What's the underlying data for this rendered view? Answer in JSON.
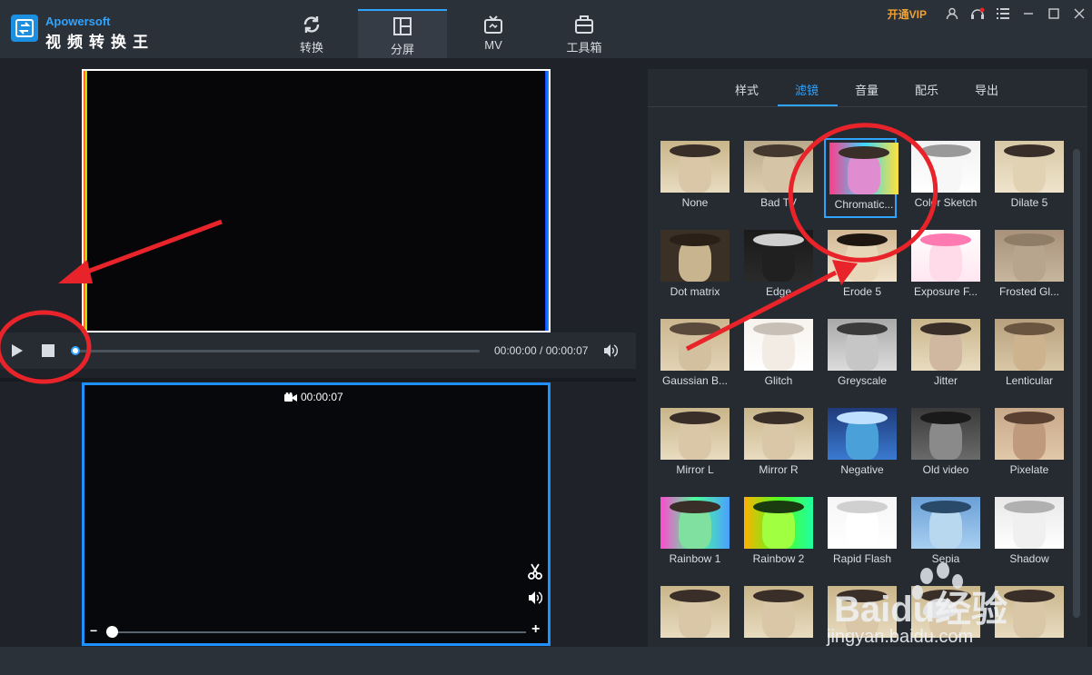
{
  "titlebar": {
    "brand": "Apowersoft",
    "app_name": "视频转换王",
    "vip_label": "开通VIP",
    "tabs": [
      {
        "label": "转换",
        "icon": "refresh-icon"
      },
      {
        "label": "分屏",
        "icon": "split-screen-icon"
      },
      {
        "label": "MV",
        "icon": "tv-icon"
      },
      {
        "label": "工具箱",
        "icon": "toolbox-icon"
      }
    ],
    "active_tab": "分屏"
  },
  "player_top": {
    "time": "00:00:00 / 00:00:07",
    "progress": 0
  },
  "player_bottom": {
    "clip_duration": "00:00:07",
    "zoom_minus": "−",
    "zoom_plus": "+"
  },
  "panel": {
    "tabs": [
      "样式",
      "滤镜",
      "音量",
      "配乐",
      "导出"
    ],
    "active_tab": "滤镜",
    "selected_filter": "Chromatic...",
    "filters": [
      "None",
      "Bad TV",
      "Chromatic...",
      "Color Sketch",
      "Dilate 5",
      "Dot matrix",
      "Edge",
      "Erode 5",
      "Exposure F...",
      "Frosted Gl...",
      "Gaussian B...",
      "Glitch",
      "Greyscale",
      "Jitter",
      "Lenticular",
      "Mirror L",
      "Mirror R",
      "Negative",
      "Old video",
      "Pixelate",
      "Rainbow 1",
      "Rainbow 2",
      "Rapid Flash",
      "Sepia",
      "Shadow",
      "",
      "",
      "",
      "",
      ""
    ]
  },
  "watermark": {
    "text": "Baidu经验",
    "url": "jingyan.baidu.com"
  },
  "colors": {
    "accent": "#2fa4ff",
    "vip": "#f0a030",
    "annotation": "#e8242a"
  }
}
